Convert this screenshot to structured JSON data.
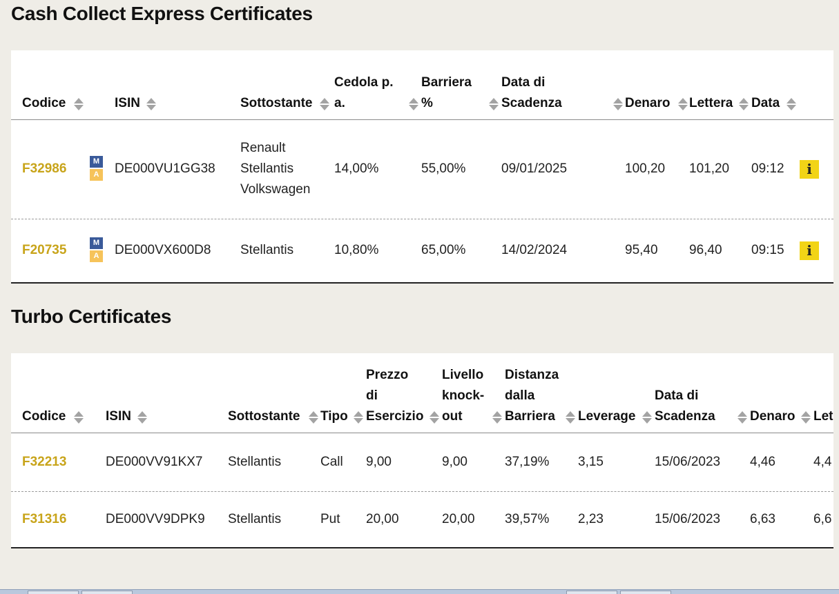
{
  "cash": {
    "title": "Cash Collect Express Certificates",
    "headers": {
      "codice": "Codice",
      "isin": "ISIN",
      "sottostante": "Sottostante",
      "cedola": [
        "Cedola p.",
        "a."
      ],
      "barriera": [
        "Barriera",
        "%"
      ],
      "scadenza": [
        "Data di",
        "Scadenza"
      ],
      "denaro": "Denaro",
      "lettera": "Lettera",
      "data": "Data"
    },
    "rows": [
      {
        "codice": "F32986",
        "badge_m": "M",
        "badge_a": "A",
        "isin": "DE000VU1GG38",
        "sottostante": [
          "Renault",
          "Stellantis",
          "Volkswagen"
        ],
        "cedola": "14,00%",
        "barriera": "55,00%",
        "scadenza": "09/01/2025",
        "denaro": "100,20",
        "lettera": "101,20",
        "data": "09:12",
        "info": "i"
      },
      {
        "codice": "F20735",
        "badge_m": "M",
        "badge_a": "A",
        "isin": "DE000VX600D8",
        "sottostante": [
          "Stellantis"
        ],
        "cedola": "10,80%",
        "barriera": "65,00%",
        "scadenza": "14/02/2024",
        "denaro": "95,40",
        "lettera": "96,40",
        "data": "09:15",
        "info": "i"
      }
    ]
  },
  "turbo": {
    "title": "Turbo Certificates",
    "headers": {
      "codice": "Codice",
      "isin": "ISIN",
      "sottostante": "Sottostante",
      "tipo": "Tipo",
      "prezzo": [
        "Prezzo",
        "di",
        "Esercizio"
      ],
      "knockout": [
        "Livello",
        "knock-",
        "out"
      ],
      "distanza": [
        "Distanza",
        "dalla",
        "Barriera"
      ],
      "leverage": "Leverage",
      "scadenza": [
        "Data di",
        "Scadenza"
      ],
      "denaro": "Denaro",
      "lettera": "Let"
    },
    "rows": [
      {
        "codice": "F32213",
        "isin": "DE000VV91KX7",
        "sottostante": "Stellantis",
        "tipo": "Call",
        "prezzo": "9,00",
        "knockout": "9,00",
        "distanza": "37,19%",
        "leverage": "3,15",
        "scadenza": "15/06/2023",
        "denaro": "4,46",
        "lettera": "4,4"
      },
      {
        "codice": "F31316",
        "isin": "DE000VV9DPK9",
        "sottostante": "Stellantis",
        "tipo": "Put",
        "prezzo": "20,00",
        "knockout": "20,00",
        "distanza": "39,57%",
        "leverage": "2,23",
        "scadenza": "15/06/2023",
        "denaro": "6,63",
        "lettera": "6,6"
      }
    ]
  },
  "colors": {
    "page_bg": "#efede7",
    "code_link": "#c8a41a",
    "info_button": "#f2d416",
    "badge_m": "#3a5a9a",
    "badge_a": "#f6c35a"
  }
}
